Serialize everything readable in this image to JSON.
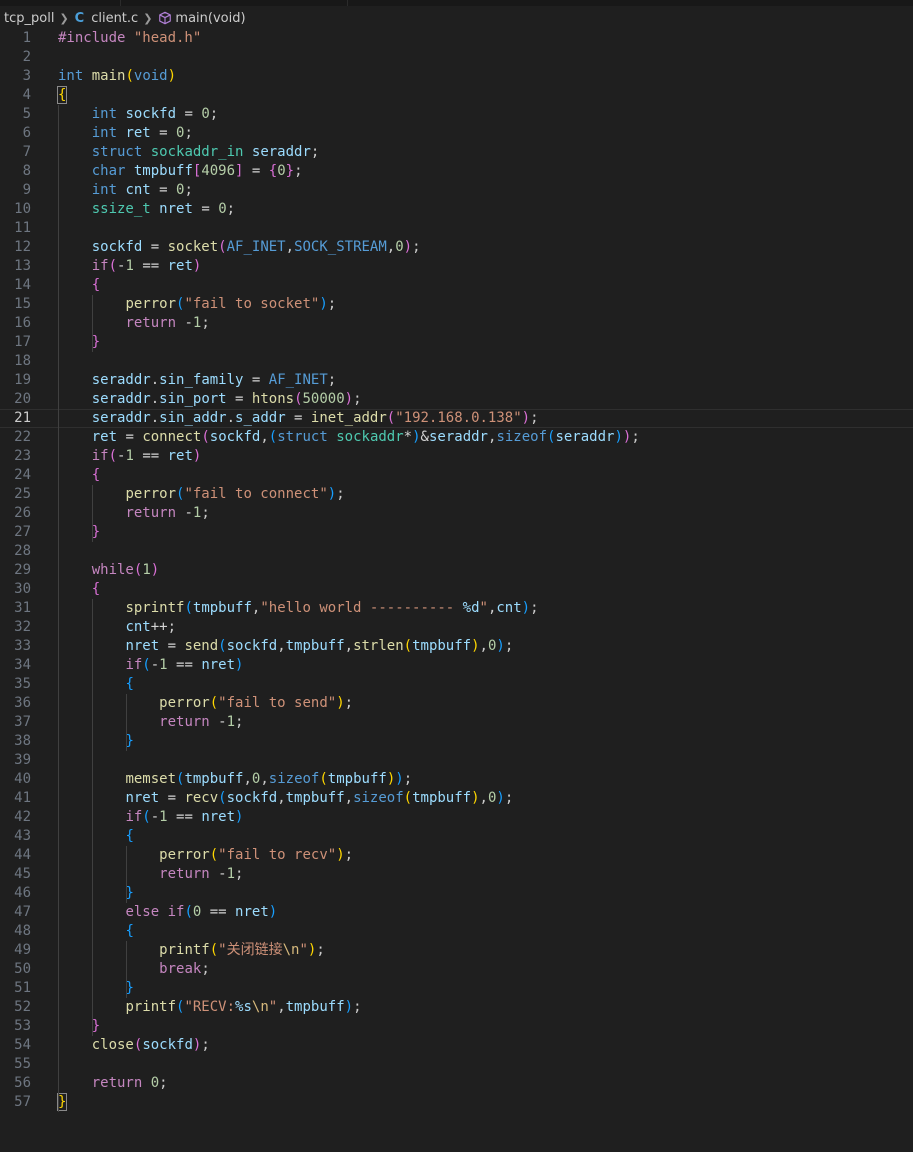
{
  "breadcrumb": {
    "folder": "tcp_poll",
    "file": "client.c",
    "file_icon": "C",
    "symbol": "main(void)"
  },
  "editor": {
    "current_line": 21,
    "lines": [
      [
        [
          "pp",
          "#include "
        ],
        [
          "str",
          "\"head.h\""
        ]
      ],
      [],
      [
        [
          "kw",
          "int"
        ],
        [
          "pl",
          " "
        ],
        [
          "fn",
          "main"
        ],
        [
          "p1",
          "("
        ],
        [
          "kw",
          "void"
        ],
        [
          "p1",
          ")"
        ]
      ],
      [
        [
          "p1",
          "{"
        ]
      ],
      [
        [
          "pl",
          "    "
        ],
        [
          "kw",
          "int"
        ],
        [
          "pl",
          " "
        ],
        [
          "var",
          "sockfd"
        ],
        [
          "op",
          " = "
        ],
        [
          "num",
          "0"
        ],
        [
          "pl",
          ";"
        ]
      ],
      [
        [
          "pl",
          "    "
        ],
        [
          "kw",
          "int"
        ],
        [
          "pl",
          " "
        ],
        [
          "var",
          "ret"
        ],
        [
          "op",
          " = "
        ],
        [
          "num",
          "0"
        ],
        [
          "pl",
          ";"
        ]
      ],
      [
        [
          "pl",
          "    "
        ],
        [
          "kw",
          "struct"
        ],
        [
          "pl",
          " "
        ],
        [
          "type",
          "sockaddr_in"
        ],
        [
          "pl",
          " "
        ],
        [
          "var",
          "seraddr"
        ],
        [
          "pl",
          ";"
        ]
      ],
      [
        [
          "pl",
          "    "
        ],
        [
          "kw",
          "char"
        ],
        [
          "pl",
          " "
        ],
        [
          "var",
          "tmpbuff"
        ],
        [
          "p2",
          "["
        ],
        [
          "num",
          "4096"
        ],
        [
          "p2",
          "]"
        ],
        [
          "op",
          " = "
        ],
        [
          "p2",
          "{"
        ],
        [
          "num",
          "0"
        ],
        [
          "p2",
          "}"
        ],
        [
          "pl",
          ";"
        ]
      ],
      [
        [
          "pl",
          "    "
        ],
        [
          "kw",
          "int"
        ],
        [
          "pl",
          " "
        ],
        [
          "var",
          "cnt"
        ],
        [
          "op",
          " = "
        ],
        [
          "num",
          "0"
        ],
        [
          "pl",
          ";"
        ]
      ],
      [
        [
          "pl",
          "    "
        ],
        [
          "type",
          "ssize_t"
        ],
        [
          "pl",
          " "
        ],
        [
          "var",
          "nret"
        ],
        [
          "op",
          " = "
        ],
        [
          "num",
          "0"
        ],
        [
          "pl",
          ";"
        ]
      ],
      [],
      [
        [
          "pl",
          "    "
        ],
        [
          "var",
          "sockfd"
        ],
        [
          "op",
          " = "
        ],
        [
          "fn",
          "socket"
        ],
        [
          "p2",
          "("
        ],
        [
          "mac",
          "AF_INET"
        ],
        [
          "pl",
          ","
        ],
        [
          "mac",
          "SOCK_STREAM"
        ],
        [
          "pl",
          ","
        ],
        [
          "num",
          "0"
        ],
        [
          "p2",
          ")"
        ],
        [
          "pl",
          ";"
        ]
      ],
      [
        [
          "pl",
          "    "
        ],
        [
          "ctl",
          "if"
        ],
        [
          "p2",
          "("
        ],
        [
          "op",
          "-"
        ],
        [
          "num",
          "1"
        ],
        [
          "op",
          " == "
        ],
        [
          "var",
          "ret"
        ],
        [
          "p2",
          ")"
        ]
      ],
      [
        [
          "pl",
          "    "
        ],
        [
          "p2",
          "{"
        ]
      ],
      [
        [
          "pl",
          "        "
        ],
        [
          "fn",
          "perror"
        ],
        [
          "p3",
          "("
        ],
        [
          "str",
          "\"fail to socket\""
        ],
        [
          "p3",
          ")"
        ],
        [
          "pl",
          ";"
        ]
      ],
      [
        [
          "pl",
          "        "
        ],
        [
          "ctl",
          "return"
        ],
        [
          "pl",
          " "
        ],
        [
          "op",
          "-"
        ],
        [
          "num",
          "1"
        ],
        [
          "pl",
          ";"
        ]
      ],
      [
        [
          "pl",
          "    "
        ],
        [
          "p2",
          "}"
        ]
      ],
      [],
      [
        [
          "pl",
          "    "
        ],
        [
          "var",
          "seraddr"
        ],
        [
          "pl",
          "."
        ],
        [
          "var",
          "sin_family"
        ],
        [
          "op",
          " = "
        ],
        [
          "mac",
          "AF_INET"
        ],
        [
          "pl",
          ";"
        ]
      ],
      [
        [
          "pl",
          "    "
        ],
        [
          "var",
          "seraddr"
        ],
        [
          "pl",
          "."
        ],
        [
          "var",
          "sin_port"
        ],
        [
          "op",
          " = "
        ],
        [
          "fn",
          "htons"
        ],
        [
          "p2",
          "("
        ],
        [
          "num",
          "50000"
        ],
        [
          "p2",
          ")"
        ],
        [
          "pl",
          ";"
        ]
      ],
      [
        [
          "pl",
          "    "
        ],
        [
          "var",
          "seraddr"
        ],
        [
          "pl",
          "."
        ],
        [
          "var",
          "sin_addr"
        ],
        [
          "pl",
          "."
        ],
        [
          "var",
          "s_addr"
        ],
        [
          "op",
          " = "
        ],
        [
          "fn",
          "inet_addr"
        ],
        [
          "p2",
          "("
        ],
        [
          "str",
          "\"192.168.0.138\""
        ],
        [
          "p2",
          ")"
        ],
        [
          "pl",
          ";"
        ]
      ],
      [
        [
          "pl",
          "    "
        ],
        [
          "var",
          "ret"
        ],
        [
          "op",
          " = "
        ],
        [
          "fn",
          "connect"
        ],
        [
          "p2",
          "("
        ],
        [
          "var",
          "sockfd"
        ],
        [
          "pl",
          ","
        ],
        [
          "p3",
          "("
        ],
        [
          "kw",
          "struct"
        ],
        [
          "pl",
          " "
        ],
        [
          "type",
          "sockaddr"
        ],
        [
          "op",
          "*"
        ],
        [
          "p3",
          ")"
        ],
        [
          "op",
          "&"
        ],
        [
          "var",
          "seraddr"
        ],
        [
          "pl",
          ","
        ],
        [
          "kw",
          "sizeof"
        ],
        [
          "p3",
          "("
        ],
        [
          "var",
          "seraddr"
        ],
        [
          "p3",
          ")"
        ],
        [
          "p2",
          ")"
        ],
        [
          "pl",
          ";"
        ]
      ],
      [
        [
          "pl",
          "    "
        ],
        [
          "ctl",
          "if"
        ],
        [
          "p2",
          "("
        ],
        [
          "op",
          "-"
        ],
        [
          "num",
          "1"
        ],
        [
          "op",
          " == "
        ],
        [
          "var",
          "ret"
        ],
        [
          "p2",
          ")"
        ]
      ],
      [
        [
          "pl",
          "    "
        ],
        [
          "p2",
          "{"
        ]
      ],
      [
        [
          "pl",
          "        "
        ],
        [
          "fn",
          "perror"
        ],
        [
          "p3",
          "("
        ],
        [
          "str",
          "\"fail to connect\""
        ],
        [
          "p3",
          ")"
        ],
        [
          "pl",
          ";"
        ]
      ],
      [
        [
          "pl",
          "        "
        ],
        [
          "ctl",
          "return"
        ],
        [
          "pl",
          " "
        ],
        [
          "op",
          "-"
        ],
        [
          "num",
          "1"
        ],
        [
          "pl",
          ";"
        ]
      ],
      [
        [
          "pl",
          "    "
        ],
        [
          "p2",
          "}"
        ]
      ],
      [],
      [
        [
          "pl",
          "    "
        ],
        [
          "ctl",
          "while"
        ],
        [
          "p2",
          "("
        ],
        [
          "num",
          "1"
        ],
        [
          "p2",
          ")"
        ]
      ],
      [
        [
          "pl",
          "    "
        ],
        [
          "p2",
          "{"
        ]
      ],
      [
        [
          "pl",
          "        "
        ],
        [
          "fn",
          "sprintf"
        ],
        [
          "p3",
          "("
        ],
        [
          "var",
          "tmpbuff"
        ],
        [
          "pl",
          ","
        ],
        [
          "str",
          "\"hello world ---------- "
        ],
        [
          "var",
          "%d"
        ],
        [
          "str",
          "\""
        ],
        [
          "pl",
          ","
        ],
        [
          "var",
          "cnt"
        ],
        [
          "p3",
          ")"
        ],
        [
          "pl",
          ";"
        ]
      ],
      [
        [
          "pl",
          "        "
        ],
        [
          "var",
          "cnt"
        ],
        [
          "op",
          "++"
        ],
        [
          "pl",
          ";"
        ]
      ],
      [
        [
          "pl",
          "        "
        ],
        [
          "var",
          "nret"
        ],
        [
          "op",
          " = "
        ],
        [
          "fn",
          "send"
        ],
        [
          "p3",
          "("
        ],
        [
          "var",
          "sockfd"
        ],
        [
          "pl",
          ","
        ],
        [
          "var",
          "tmpbuff"
        ],
        [
          "pl",
          ","
        ],
        [
          "fn",
          "strlen"
        ],
        [
          "p1",
          "("
        ],
        [
          "var",
          "tmpbuff"
        ],
        [
          "p1",
          ")"
        ],
        [
          "pl",
          ","
        ],
        [
          "num",
          "0"
        ],
        [
          "p3",
          ")"
        ],
        [
          "pl",
          ";"
        ]
      ],
      [
        [
          "pl",
          "        "
        ],
        [
          "ctl",
          "if"
        ],
        [
          "p3",
          "("
        ],
        [
          "op",
          "-"
        ],
        [
          "num",
          "1"
        ],
        [
          "op",
          " == "
        ],
        [
          "var",
          "nret"
        ],
        [
          "p3",
          ")"
        ]
      ],
      [
        [
          "pl",
          "        "
        ],
        [
          "p3",
          "{"
        ]
      ],
      [
        [
          "pl",
          "            "
        ],
        [
          "fn",
          "perror"
        ],
        [
          "p1",
          "("
        ],
        [
          "str",
          "\"fail to send\""
        ],
        [
          "p1",
          ")"
        ],
        [
          "pl",
          ";"
        ]
      ],
      [
        [
          "pl",
          "            "
        ],
        [
          "ctl",
          "return"
        ],
        [
          "pl",
          " "
        ],
        [
          "op",
          "-"
        ],
        [
          "num",
          "1"
        ],
        [
          "pl",
          ";"
        ]
      ],
      [
        [
          "pl",
          "        "
        ],
        [
          "p3",
          "}"
        ]
      ],
      [],
      [
        [
          "pl",
          "        "
        ],
        [
          "fn",
          "memset"
        ],
        [
          "p3",
          "("
        ],
        [
          "var",
          "tmpbuff"
        ],
        [
          "pl",
          ","
        ],
        [
          "num",
          "0"
        ],
        [
          "pl",
          ","
        ],
        [
          "kw",
          "sizeof"
        ],
        [
          "p1",
          "("
        ],
        [
          "var",
          "tmpbuff"
        ],
        [
          "p1",
          ")"
        ],
        [
          "p3",
          ")"
        ],
        [
          "pl",
          ";"
        ]
      ],
      [
        [
          "pl",
          "        "
        ],
        [
          "var",
          "nret"
        ],
        [
          "op",
          " = "
        ],
        [
          "fn",
          "recv"
        ],
        [
          "p3",
          "("
        ],
        [
          "var",
          "sockfd"
        ],
        [
          "pl",
          ","
        ],
        [
          "var",
          "tmpbuff"
        ],
        [
          "pl",
          ","
        ],
        [
          "kw",
          "sizeof"
        ],
        [
          "p1",
          "("
        ],
        [
          "var",
          "tmpbuff"
        ],
        [
          "p1",
          ")"
        ],
        [
          "pl",
          ","
        ],
        [
          "num",
          "0"
        ],
        [
          "p3",
          ")"
        ],
        [
          "pl",
          ";"
        ]
      ],
      [
        [
          "pl",
          "        "
        ],
        [
          "ctl",
          "if"
        ],
        [
          "p3",
          "("
        ],
        [
          "op",
          "-"
        ],
        [
          "num",
          "1"
        ],
        [
          "op",
          " == "
        ],
        [
          "var",
          "nret"
        ],
        [
          "p3",
          ")"
        ]
      ],
      [
        [
          "pl",
          "        "
        ],
        [
          "p3",
          "{"
        ]
      ],
      [
        [
          "pl",
          "            "
        ],
        [
          "fn",
          "perror"
        ],
        [
          "p1",
          "("
        ],
        [
          "str",
          "\"fail to recv\""
        ],
        [
          "p1",
          ")"
        ],
        [
          "pl",
          ";"
        ]
      ],
      [
        [
          "pl",
          "            "
        ],
        [
          "ctl",
          "return"
        ],
        [
          "pl",
          " "
        ],
        [
          "op",
          "-"
        ],
        [
          "num",
          "1"
        ],
        [
          "pl",
          ";"
        ]
      ],
      [
        [
          "pl",
          "        "
        ],
        [
          "p3",
          "}"
        ]
      ],
      [
        [
          "pl",
          "        "
        ],
        [
          "ctl",
          "else"
        ],
        [
          "pl",
          " "
        ],
        [
          "ctl",
          "if"
        ],
        [
          "p3",
          "("
        ],
        [
          "num",
          "0"
        ],
        [
          "op",
          " == "
        ],
        [
          "var",
          "nret"
        ],
        [
          "p3",
          ")"
        ]
      ],
      [
        [
          "pl",
          "        "
        ],
        [
          "p3",
          "{"
        ]
      ],
      [
        [
          "pl",
          "            "
        ],
        [
          "fn",
          "printf"
        ],
        [
          "p1",
          "("
        ],
        [
          "str",
          "\"关闭链接"
        ],
        [
          "esc",
          "\\n"
        ],
        [
          "str",
          "\""
        ],
        [
          "p1",
          ")"
        ],
        [
          "pl",
          ";"
        ]
      ],
      [
        [
          "pl",
          "            "
        ],
        [
          "ctl",
          "break"
        ],
        [
          "pl",
          ";"
        ]
      ],
      [
        [
          "pl",
          "        "
        ],
        [
          "p3",
          "}"
        ]
      ],
      [
        [
          "pl",
          "        "
        ],
        [
          "fn",
          "printf"
        ],
        [
          "p3",
          "("
        ],
        [
          "str",
          "\"RECV:"
        ],
        [
          "var",
          "%s"
        ],
        [
          "esc",
          "\\n"
        ],
        [
          "str",
          "\""
        ],
        [
          "pl",
          ","
        ],
        [
          "var",
          "tmpbuff"
        ],
        [
          "p3",
          ")"
        ],
        [
          "pl",
          ";"
        ]
      ],
      [
        [
          "pl",
          "    "
        ],
        [
          "p2",
          "}"
        ]
      ],
      [
        [
          "pl",
          "    "
        ],
        [
          "fn",
          "close"
        ],
        [
          "p2",
          "("
        ],
        [
          "var",
          "sockfd"
        ],
        [
          "p2",
          ")"
        ],
        [
          "pl",
          ";"
        ]
      ],
      [],
      [
        [
          "pl",
          "    "
        ],
        [
          "ctl",
          "return"
        ],
        [
          "pl",
          " "
        ],
        [
          "num",
          "0"
        ],
        [
          "pl",
          ";"
        ]
      ],
      [
        [
          "p1",
          "}"
        ]
      ]
    ]
  }
}
